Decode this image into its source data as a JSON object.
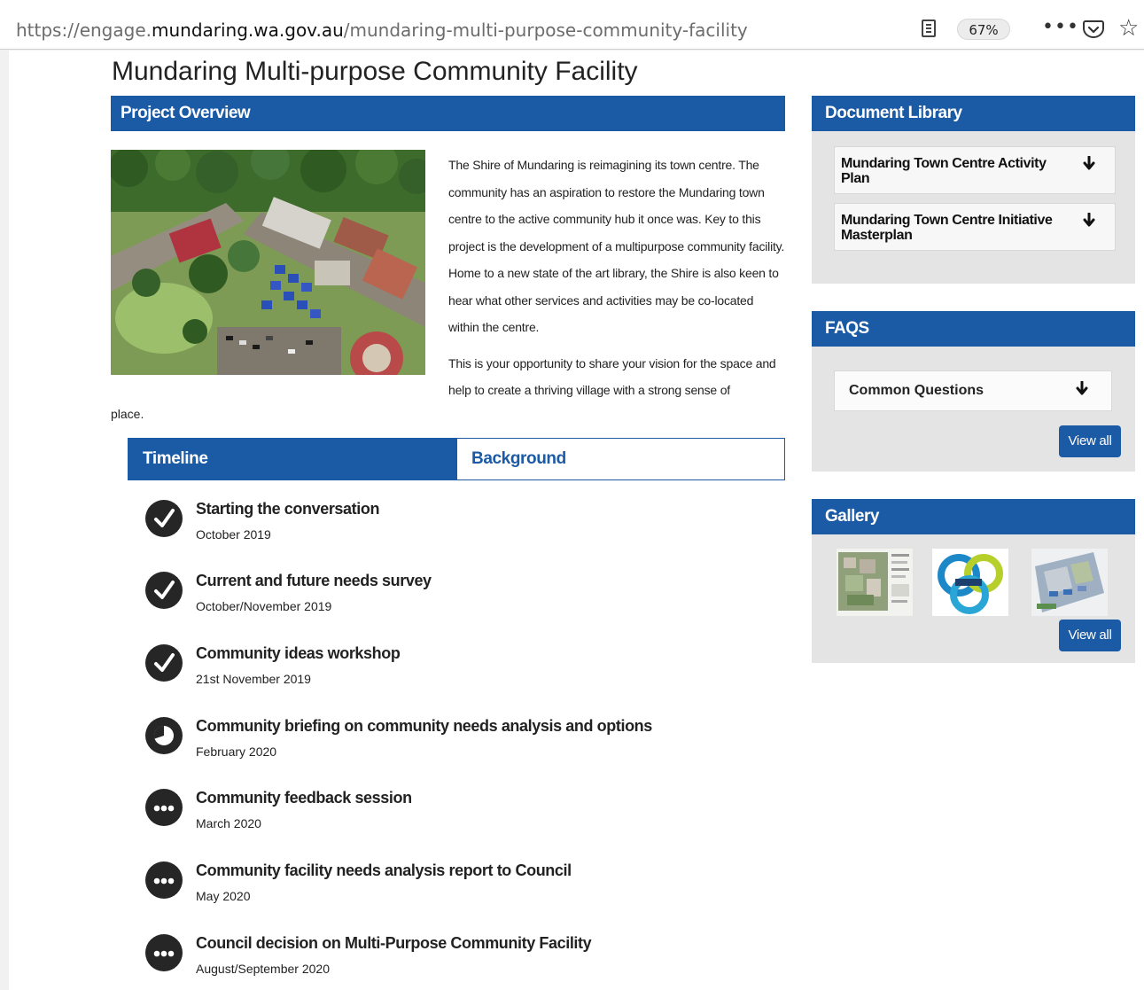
{
  "browser": {
    "url_prefix": "https://engage.",
    "url_domain": "mundaring.wa.gov.au",
    "url_path": "/mundaring-multi-purpose-community-facility",
    "zoom": "67%"
  },
  "page": {
    "title": "Mundaring Multi-purpose Community Facility"
  },
  "overview": {
    "header": "Project Overview",
    "paragraph1": "The Shire of Mundaring is reimagining its town centre. The community has an aspiration to restore the Mundaring town centre to the active community hub it once was. Key to this project is the development of a multipurpose community facility. Home to a new state of the art library, the Shire is also keen to hear what other services and activities may be co-located within the centre.",
    "paragraph2": "This is your opportunity to share your vision for the space and help to create a thriving village with a strong sense of",
    "paragraph2_end": "place."
  },
  "tabs": {
    "timeline": "Timeline",
    "background": "Background"
  },
  "timeline": [
    {
      "title": "Starting the conversation",
      "date": "October 2019",
      "status": "complete"
    },
    {
      "title": "Current and future needs survey",
      "date": "October/November 2019",
      "status": "complete"
    },
    {
      "title": "Community ideas workshop",
      "date": "21st November 2019",
      "status": "complete"
    },
    {
      "title": "Community briefing on community needs analysis and options",
      "date": "February 2020",
      "status": "in-progress"
    },
    {
      "title": "Community feedback session",
      "date": "March 2020",
      "status": "upcoming"
    },
    {
      "title": "Community facility needs analysis report to Council",
      "date": "May 2020",
      "status": "upcoming"
    },
    {
      "title": "Council decision on Multi-Purpose Community Facility",
      "date": "August/September 2020",
      "status": "upcoming"
    }
  ],
  "document_library": {
    "header": "Document Library",
    "items": [
      {
        "label": "Mundaring Town Centre Activity Plan"
      },
      {
        "label": "Mundaring Town Centre Initiative Masterplan"
      }
    ]
  },
  "faqs": {
    "header": "FAQS",
    "item": "Common Questions",
    "view_all": "View all"
  },
  "gallery": {
    "header": "Gallery",
    "view_all": "View all"
  },
  "colors": {
    "brand_blue": "#1b5aa5",
    "panel_gray": "#e4e4e4",
    "icon_dark": "#262626"
  }
}
